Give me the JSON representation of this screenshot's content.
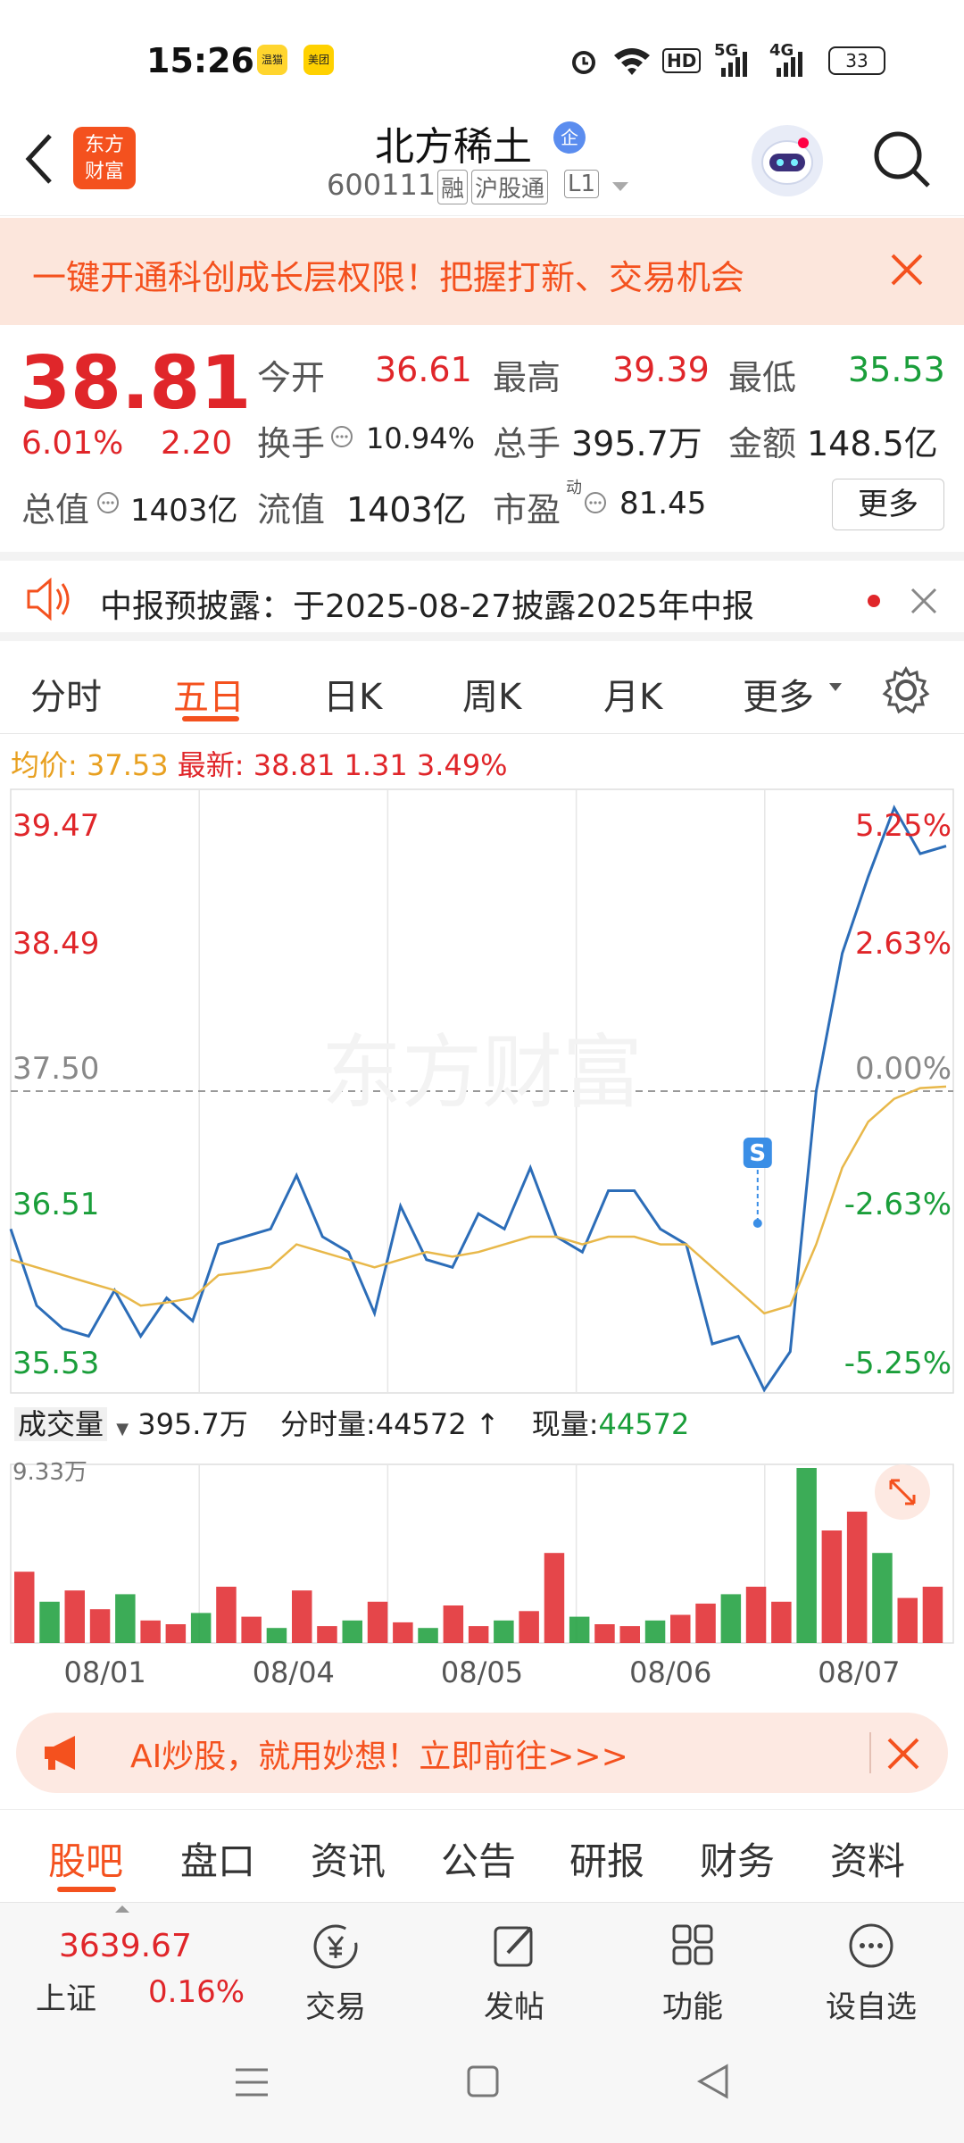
{
  "status_bar": {
    "time": "15:26",
    "app_badge_1": "温猫",
    "app_badge_2": "美团",
    "network_1": "HD",
    "network_2": "5G",
    "network_3": "4G",
    "battery": "33"
  },
  "header": {
    "logo_line1": "东方",
    "logo_line2": "财富",
    "stock_name": "北方稀土",
    "stock_badge": "企",
    "stock_code": "600111",
    "tag_margin": "融",
    "tag_connect": "沪股通",
    "tag_level": "L1"
  },
  "banner": {
    "text": "一键开通科创成长层权限！把握打新、交易机会"
  },
  "quote": {
    "price": "38.81",
    "change_pct": "6.01%",
    "change_amt": "2.20",
    "open_label": "今开",
    "open": "36.61",
    "high_label": "最高",
    "high": "39.39",
    "low_label": "最低",
    "low": "35.53",
    "turnover_label": "换手",
    "turnover": "10.94%",
    "volume_label": "总手",
    "volume": "395.7万",
    "amount_label": "金额",
    "amount": "148.5亿",
    "mktcap_label": "总值",
    "mktcap": "1403亿",
    "float_label": "流值",
    "float_cap": "1403亿",
    "pe_label": "市盈",
    "pe_sup": "动",
    "pe": "81.45",
    "more_button": "更多"
  },
  "notice": {
    "text": "中报预披露：于2025-08-27披露2025年中报"
  },
  "tabs": {
    "items": [
      "分时",
      "五日",
      "日K",
      "周K",
      "月K",
      "更多"
    ],
    "active": "五日"
  },
  "chart_info": {
    "avg_label": "均价:",
    "avg_value": "37.53",
    "latest_label": "最新:",
    "latest_value": "38.81",
    "latest_change": "1.31",
    "latest_pct": "3.49%"
  },
  "chart_data": [
    {
      "type": "line",
      "title": "",
      "x": [
        "08/01",
        "08/04",
        "08/05",
        "08/06",
        "08/07"
      ],
      "y_ticks_left": [
        "39.47",
        "38.49",
        "37.50",
        "36.51",
        "35.53"
      ],
      "y_ticks_right": [
        "5.25%",
        "2.63%",
        "0.00%",
        "-2.63%",
        "-5.25%"
      ],
      "ylim": [
        35.53,
        39.47
      ],
      "baseline": 37.5,
      "series": [
        {
          "name": "最新",
          "color": "#2c6db8",
          "values": [
            36.6,
            36.1,
            35.95,
            35.9,
            36.2,
            35.9,
            36.15,
            36.0,
            36.5,
            36.55,
            36.6,
            36.95,
            36.55,
            36.45,
            36.05,
            36.75,
            36.4,
            36.35,
            36.7,
            36.6,
            37.0,
            36.55,
            36.45,
            36.85,
            36.85,
            36.6,
            36.5,
            35.85,
            35.9,
            35.55,
            35.8,
            37.5,
            38.4,
            38.9,
            39.35,
            39.05,
            39.1
          ]
        },
        {
          "name": "均价",
          "color": "#e8b84a",
          "values": [
            36.4,
            36.35,
            36.3,
            36.25,
            36.2,
            36.1,
            36.12,
            36.15,
            36.3,
            36.32,
            36.35,
            36.5,
            36.45,
            36.4,
            36.35,
            36.4,
            36.45,
            36.42,
            36.45,
            36.5,
            36.55,
            36.55,
            36.5,
            36.55,
            36.55,
            36.5,
            36.5,
            36.35,
            36.2,
            36.05,
            36.1,
            36.5,
            37.0,
            37.3,
            37.45,
            37.52,
            37.53
          ]
        }
      ]
    },
    {
      "type": "bar",
      "title": "",
      "label": "成交量",
      "total": "395.7万",
      "fenshi_label": "分时量:",
      "fenshi_value": "44572",
      "now_label": "现量:",
      "now_value": "44572",
      "max_label": "9.33万",
      "ylim": [
        0,
        93300
      ],
      "values": [
        38000,
        22000,
        28000,
        18000,
        26000,
        12000,
        10000,
        16000,
        30000,
        14000,
        8000,
        28000,
        9000,
        12000,
        22000,
        11000,
        8000,
        20000,
        9000,
        12000,
        17000,
        48000,
        14000,
        10000,
        9000,
        12000,
        15000,
        21000,
        26000,
        30000,
        22000,
        93300,
        60000,
        70000,
        48000,
        24000,
        30000
      ]
    }
  ],
  "ai_banner": {
    "text": "AI炒股，就用妙想！立即前往>>>"
  },
  "bottom_tabs": {
    "items": [
      "股吧",
      "盘口",
      "资讯",
      "公告",
      "研报",
      "财务",
      "资料"
    ],
    "active": "股吧"
  },
  "toolbar": {
    "index_value": "3639.67",
    "index_name": "上证",
    "index_pct": "0.16%",
    "trade": "交易",
    "post": "发帖",
    "functions": "功能",
    "watchlist": "设自选"
  },
  "colors": {
    "up": "#e0262a",
    "down": "#1a9e3a",
    "accent": "#f4511e",
    "price_line": "#2c6db8",
    "avg_line": "#e8b84a"
  }
}
